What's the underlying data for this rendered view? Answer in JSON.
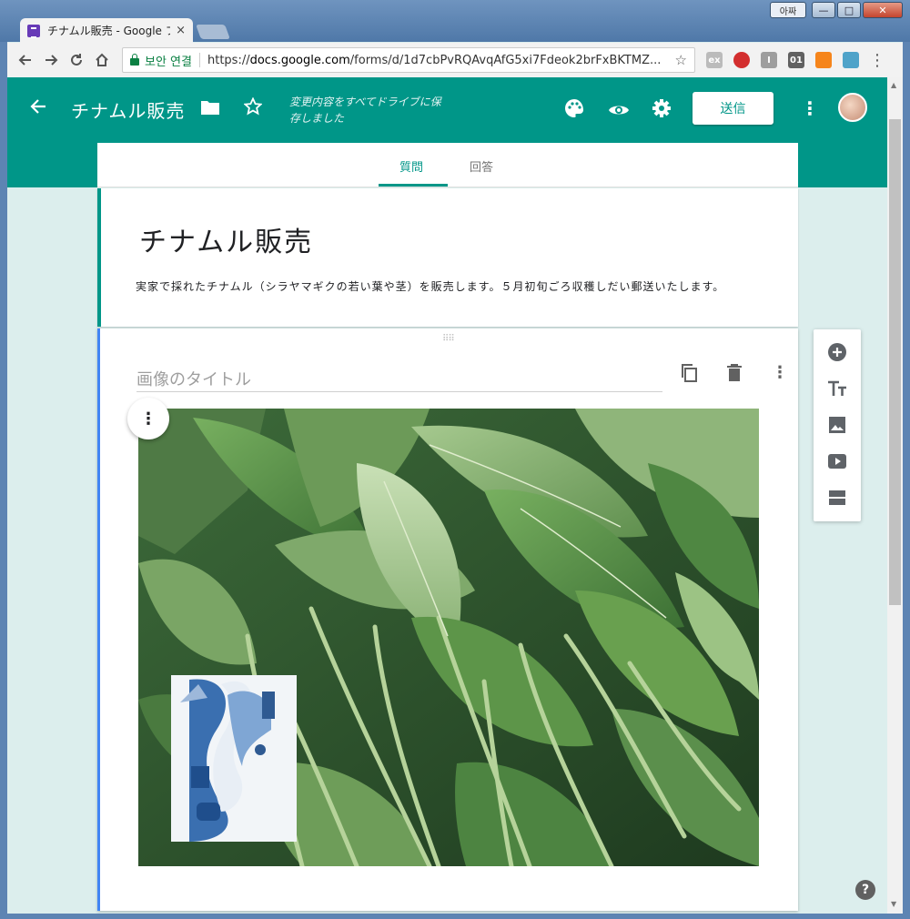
{
  "window": {
    "tab_title": "チナムル販売 - Google フ",
    "tab_close": "×",
    "ime_label": "아짜",
    "min_label": "—",
    "max_label": "□",
    "close_label": "✕"
  },
  "toolbar": {
    "secure_label": "보안 연결",
    "url_scheme": "https://",
    "url_host": "docs.google.com",
    "url_path": "/forms/d/1d7cbPvRQAvqAfG5xi7Fdeok2brFxBKTMZ...",
    "ext_labels": [
      "ex",
      "I",
      "01"
    ]
  },
  "appbar": {
    "title": "チナムル販売",
    "saved_status": "変更内容をすべてドライブに保存しました",
    "send_label": "送信"
  },
  "form_tabs": {
    "questions": "質問",
    "responses": "回答"
  },
  "form": {
    "title": "チナムル販売",
    "description": "実家で採れたチナムル（シラヤマギクの若い葉や茎）を販売します。５月初旬ごろ収穫しだい郵送いたします。"
  },
  "image_item": {
    "title_placeholder": "画像のタイトル",
    "menu_glyph": "⋮",
    "drag_glyph": "⠿⠿"
  },
  "help_label": "?",
  "colors": {
    "accent": "#009688",
    "focus": "#4285f4"
  },
  "icons": [
    "back-arrow-icon",
    "folder-icon",
    "star-icon",
    "palette-icon",
    "eye-icon",
    "settings-icon",
    "more-vert-icon",
    "copy-icon",
    "trash-icon",
    "add-circle-icon",
    "title-icon",
    "image-icon",
    "video-icon",
    "section-icon"
  ]
}
